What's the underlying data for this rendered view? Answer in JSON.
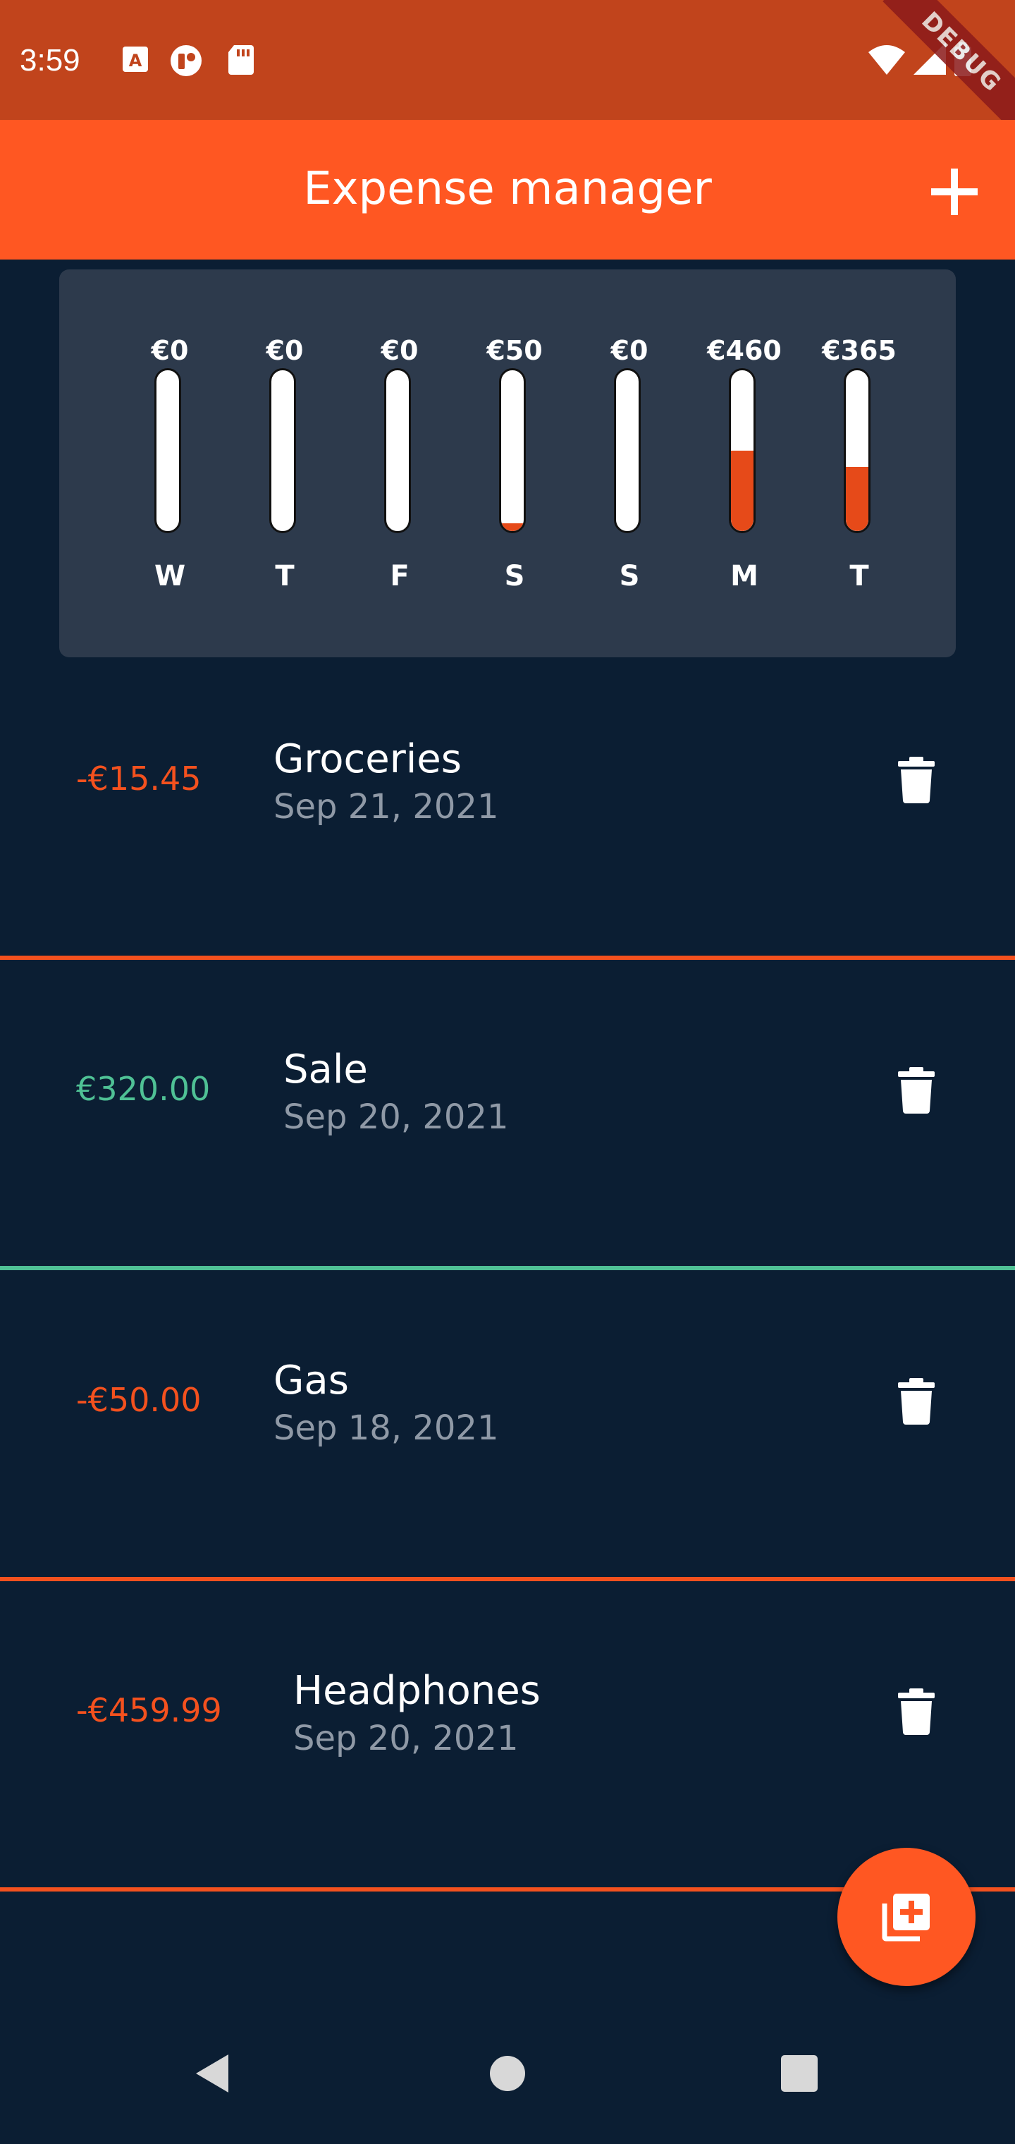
{
  "status_bar": {
    "time": "3:59",
    "debug_label": "DEBUG",
    "icons_left": [
      "a-notification-icon",
      "app-notification-icon",
      "sd-card-icon"
    ],
    "icons_right": [
      "wifi-icon",
      "signal-icon",
      "battery-icon"
    ]
  },
  "app_bar": {
    "title": "Expense manager",
    "add_icon": "plus-icon"
  },
  "chart": {
    "bars": [
      {
        "day": "W",
        "amount": "€0",
        "fill": 0
      },
      {
        "day": "T",
        "amount": "€0",
        "fill": 0
      },
      {
        "day": "F",
        "amount": "€0",
        "fill": 0
      },
      {
        "day": "S",
        "amount": "€50",
        "fill": 0.05
      },
      {
        "day": "S",
        "amount": "€0",
        "fill": 0
      },
      {
        "day": "M",
        "amount": "€460",
        "fill": 0.5
      },
      {
        "day": "T",
        "amount": "€365",
        "fill": 0.4
      }
    ]
  },
  "transactions": [
    {
      "amount": "-€15.45",
      "title": "Groceries",
      "date": "Sep 21, 2021",
      "type": "expense"
    },
    {
      "amount": "€320.00",
      "title": "Sale",
      "date": "Sep 20, 2021",
      "type": "income"
    },
    {
      "amount": "-€50.00",
      "title": "Gas",
      "date": "Sep 18, 2021",
      "type": "expense"
    },
    {
      "amount": "-€459.99",
      "title": "Headphones",
      "date": "Sep 20, 2021",
      "type": "expense"
    }
  ],
  "fab": {
    "icon": "add-expense-icon"
  },
  "nav_bar": {
    "icons": [
      "back-icon",
      "home-icon",
      "recents-icon"
    ]
  },
  "colors": {
    "status_bar": "#c1441c",
    "app_bar": "#ff5722",
    "background": "#0b1e33",
    "chart_card": "#2d3a4c",
    "expense": "#f4511e",
    "income": "#4fc195",
    "date_text": "#8f99a6"
  }
}
